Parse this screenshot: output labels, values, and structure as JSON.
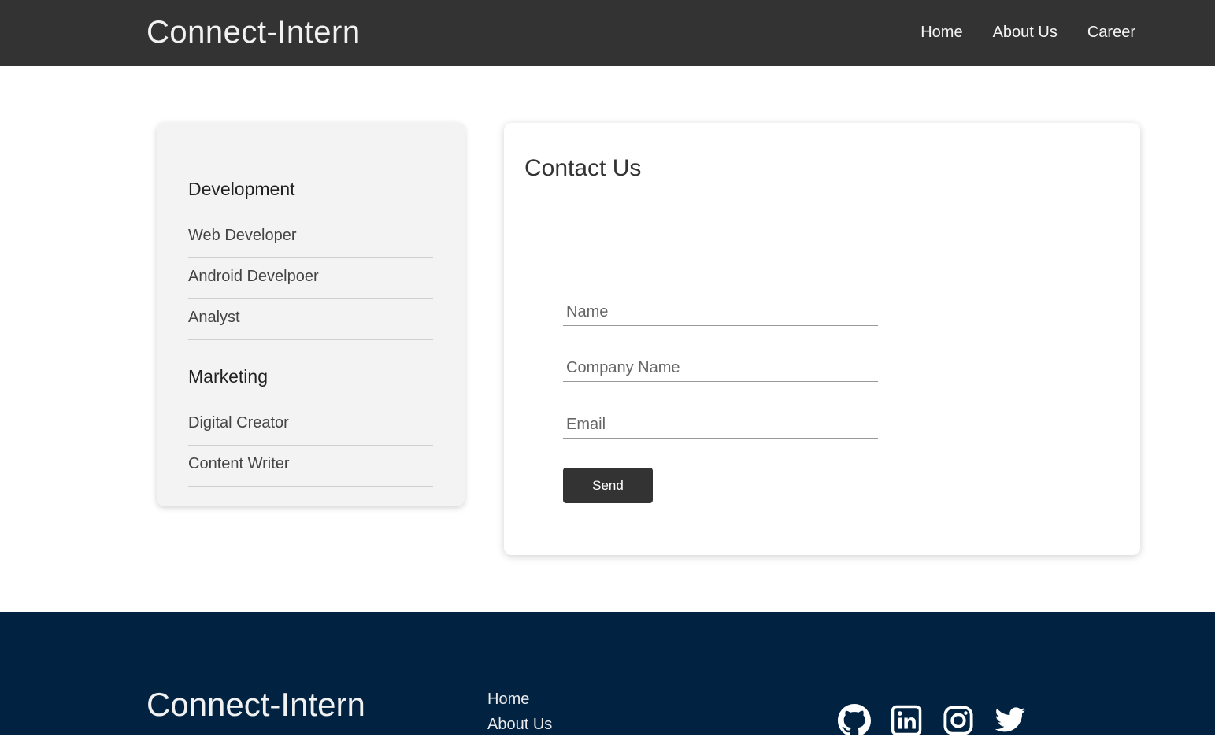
{
  "header": {
    "brand": "Connect-Intern",
    "nav": [
      "Home",
      "About Us",
      "Career"
    ]
  },
  "sidebar": {
    "groups": [
      {
        "title": "Development",
        "items": [
          "Web Developer",
          "Android Develpoer",
          "Analyst"
        ]
      },
      {
        "title": "Marketing",
        "items": [
          "Digital Creator",
          "Content Writer"
        ]
      }
    ]
  },
  "contact": {
    "title": "Contact Us",
    "name_placeholder": "Name",
    "company_placeholder": "Company Name",
    "email_placeholder": "Email",
    "send_label": "Send"
  },
  "footer": {
    "brand": "Connect-Intern",
    "links": [
      "Home",
      "About Us"
    ],
    "socials": [
      "github-icon",
      "linkedin-icon",
      "instagram-icon",
      "twitter-icon"
    ]
  },
  "colors": {
    "header_bg": "#333333",
    "footer_bg": "#012341",
    "sidebar_bg": "#f3f3f3",
    "button_bg": "#333333"
  }
}
